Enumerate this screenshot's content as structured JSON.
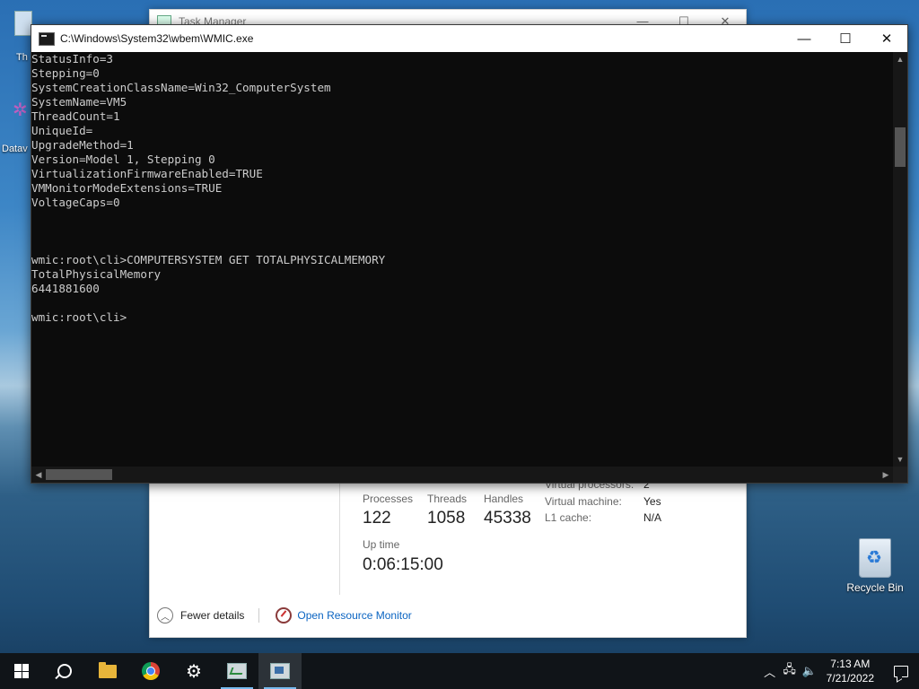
{
  "desktop": {
    "recycle_bin_label": "Recycle Bin",
    "left_fragment_1": "Th",
    "left_fragment_2": "Datav"
  },
  "task_manager": {
    "title": "Task Manager",
    "processes_label": "Processes",
    "processes_value": "122",
    "threads_label": "Threads",
    "threads_value": "1058",
    "handles_label": "Handles",
    "handles_value": "45338",
    "uptime_label": "Up time",
    "uptime_value": "0:06:15:00",
    "virtual_processors_label": "Virtual processors:",
    "virtual_processors_value": "2",
    "virtual_machine_label": "Virtual machine:",
    "virtual_machine_value": "Yes",
    "l1_cache_label": "L1 cache:",
    "l1_cache_value": "N/A",
    "fewer_details": "Fewer details",
    "open_resource_monitor": "Open Resource Monitor"
  },
  "console": {
    "title": "C:\\Windows\\System32\\wbem\\WMIC.exe",
    "output": "StatusInfo=3\nStepping=0\nSystemCreationClassName=Win32_ComputerSystem\nSystemName=VM5\nThreadCount=1\nUniqueId=\nUpgradeMethod=1\nVersion=Model 1, Stepping 0\nVirtualizationFirmwareEnabled=TRUE\nVMMonitorModeExtensions=TRUE\nVoltageCaps=0\n\n\n\nwmic:root\\cli>COMPUTERSYSTEM GET TOTALPHYSICALMEMORY\nTotalPhysicalMemory\n6441881600\n\nwmic:root\\cli>"
  },
  "taskbar": {
    "clock_time": "7:13 AM",
    "clock_date": "7/21/2022"
  }
}
